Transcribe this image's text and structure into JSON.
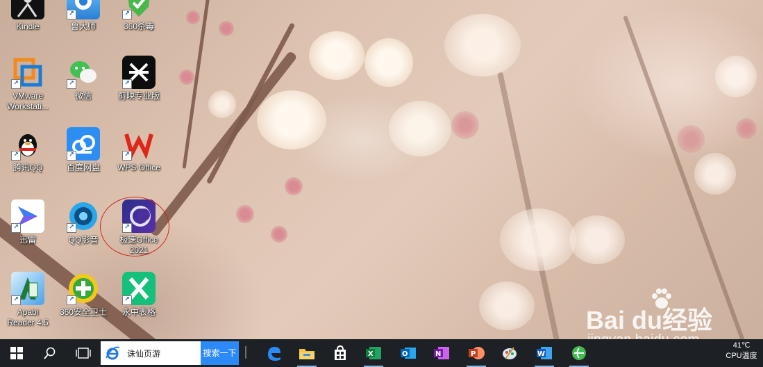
{
  "desktop": {
    "icons": [
      {
        "label": "Kindle",
        "icon": "kindle-icon"
      },
      {
        "label": "鲁大师",
        "icon": "ludashi-icon"
      },
      {
        "label": "360杀毒",
        "icon": "360-antivirus-icon"
      },
      {
        "label": "VMware Workstati...",
        "icon": "vmware-icon"
      },
      {
        "label": "微信",
        "icon": "wechat-icon"
      },
      {
        "label": "剪映专业版",
        "icon": "jianying-icon"
      },
      {
        "label": "腾讯QQ",
        "icon": "qq-icon"
      },
      {
        "label": "百度网盘",
        "icon": "baidu-netdisk-icon"
      },
      {
        "label": "WPS Office",
        "icon": "wps-office-icon"
      },
      {
        "label": "迅雷",
        "icon": "xunlei-icon"
      },
      {
        "label": "QQ影音",
        "icon": "qq-player-icon"
      },
      {
        "label": "极速Office 2021",
        "icon": "jisu-office-icon"
      },
      {
        "label": "Apabi Reader 4.5",
        "icon": "apabi-reader-icon"
      },
      {
        "label": "360安全卫士",
        "icon": "360-safeguard-icon"
      },
      {
        "label": "永中表格",
        "icon": "yozo-sheet-icon"
      }
    ],
    "watermark": {
      "main": "Bai du经验",
      "sub": "jingyan.baidu.com"
    }
  },
  "taskbar": {
    "search": {
      "text": "诛仙页游",
      "button": "搜索一下"
    },
    "apps": [
      "edge-icon",
      "file-explorer-icon",
      "store-icon",
      "excel-icon",
      "outlook-icon",
      "onenote-icon",
      "powerpoint-icon",
      "paint-icon",
      "word-icon",
      "360-browser-icon"
    ],
    "tray": {
      "temp": "41℃",
      "label": "CPU温度"
    }
  },
  "colors": {
    "taskbar": "#1d2125",
    "search_button": "#2b8af7",
    "highlight_circle": "#d0241f"
  }
}
